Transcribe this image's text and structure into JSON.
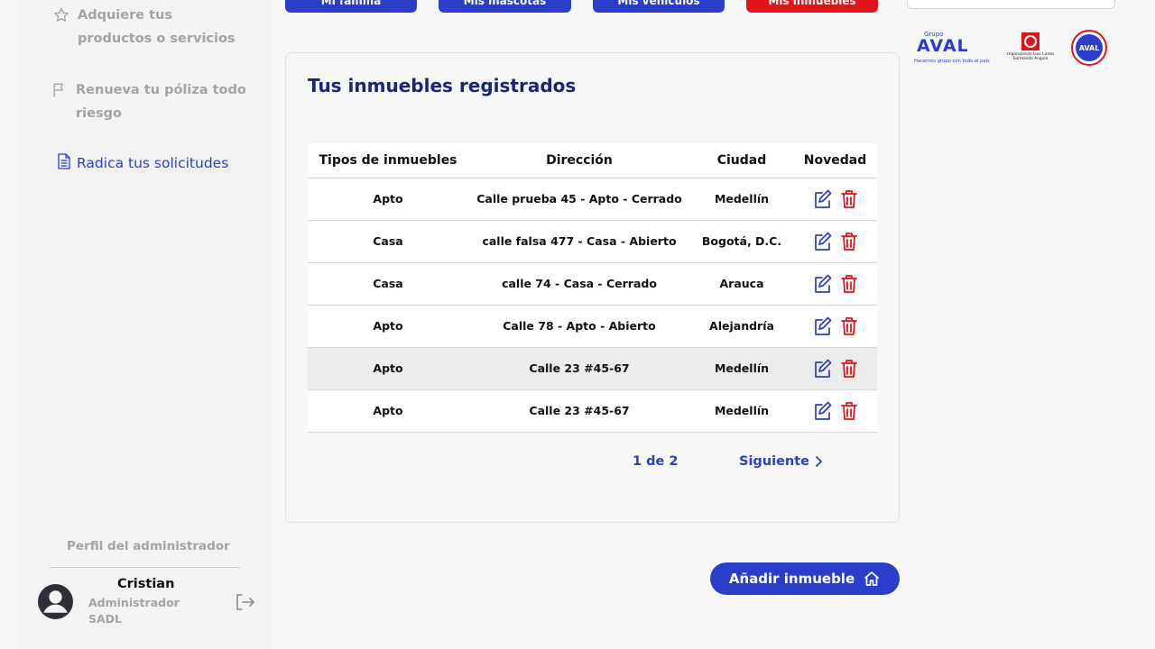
{
  "sidebar": {
    "items": [
      {
        "label": "Adquiere tus productos o servicios",
        "icon": "star-icon"
      },
      {
        "label": "Renueva tu póliza todo riesgo",
        "icon": "flag-icon"
      },
      {
        "label": "Radica tus solicitudes",
        "icon": "document-icon"
      }
    ],
    "profile": {
      "title": "Perfil del administrador",
      "name": "Cristian",
      "role": "Administrador SADL"
    }
  },
  "top_buttons": [
    {
      "label": "Mi familia"
    },
    {
      "label": "Mis mascotas"
    },
    {
      "label": "Mis vehículos"
    },
    {
      "label": "Mis inmuebles"
    }
  ],
  "logos": {
    "aval_small": "Grupo",
    "aval_brand": "AVAL",
    "aval_tagline": "Hacemos grupo con todo el país",
    "org_name": "Organización Luis Carlos Sarmiento Angulo",
    "circle_brand": "AVAL"
  },
  "card": {
    "title": "Tus inmuebles registrados",
    "columns": [
      "Tipos de inmuebles",
      "Dirección",
      "Ciudad",
      "Novedad"
    ],
    "rows": [
      {
        "tipo": "Apto",
        "direccion": "Calle prueba 45 - Apto - Cerrado",
        "ciudad": "Medellín"
      },
      {
        "tipo": "Casa",
        "direccion": "calle falsa 477 - Casa - Abierto",
        "ciudad": "Bogotá, D.C."
      },
      {
        "tipo": "Casa",
        "direccion": "calle 74 - Casa - Cerrado",
        "ciudad": "Arauca"
      },
      {
        "tipo": "Apto",
        "direccion": "Calle 78 - Apto - Abierto",
        "ciudad": "Alejandría"
      },
      {
        "tipo": "Apto",
        "direccion": "Calle 23 #45-67",
        "ciudad": "Medellín"
      },
      {
        "tipo": "Apto",
        "direccion": "Calle 23 #45-67",
        "ciudad": "Medellín"
      }
    ],
    "pagination": {
      "page_text": "1 de 2",
      "next_label": "Siguiente"
    }
  },
  "add_button": {
    "label": "Añadir inmueble",
    "icon": "home-icon"
  },
  "colors": {
    "accent": "#2b3ec9",
    "danger": "#e1141c",
    "title": "#1a237e"
  }
}
